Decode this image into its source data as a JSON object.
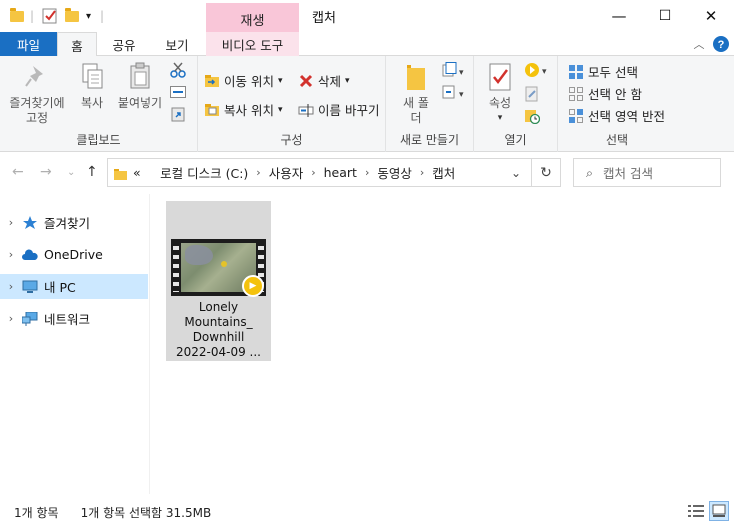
{
  "window": {
    "title": "캡처",
    "context_tab_header": "재생",
    "minimize": "—",
    "maximize": "☐",
    "close": "✕"
  },
  "tabs": {
    "file": "파일",
    "home": "홈",
    "share": "공유",
    "view": "보기",
    "video_tools": "비디오 도구"
  },
  "ribbon": {
    "clipboard": {
      "pin_quick_access": "즐겨찾기에 고정",
      "copy": "복사",
      "paste": "붙여넣기",
      "label": "클립보드"
    },
    "organize": {
      "move_to": "이동 위치",
      "copy_to": "복사 위치",
      "delete": "삭제",
      "rename": "이름 바꾸기",
      "label": "구성"
    },
    "new": {
      "new_folder": "새 폴더",
      "label": "새로 만들기"
    },
    "open": {
      "properties": "속성",
      "label": "열기"
    },
    "select": {
      "select_all": "모두 선택",
      "select_none": "선택 안 함",
      "invert_selection": "선택 영역 반전",
      "label": "선택"
    }
  },
  "address": {
    "overflow": "«",
    "crumbs": [
      "로컬 디스크 (C:)",
      "사용자",
      "heart",
      "동영상",
      "캡처"
    ],
    "search_placeholder": "캡처 검색"
  },
  "nav_pane": {
    "items": [
      "즐겨찾기",
      "OneDrive",
      "내 PC",
      "네트워크"
    ],
    "selected": "내 PC"
  },
  "files": [
    {
      "name_lines": [
        "Lonely",
        "Mountains_",
        "Downhill",
        "2022-04-09 ..."
      ],
      "type": "video"
    }
  ],
  "status": {
    "item_count": "1개 항목",
    "selection": "1개 항목 선택함 31.5MB"
  },
  "colors": {
    "file_tab": "#1a6fc3",
    "context_tab": "#f9c6d8",
    "selected_nav": "#cce8ff",
    "selected_file": "#d9d9d9",
    "folder": "#f5c542"
  }
}
